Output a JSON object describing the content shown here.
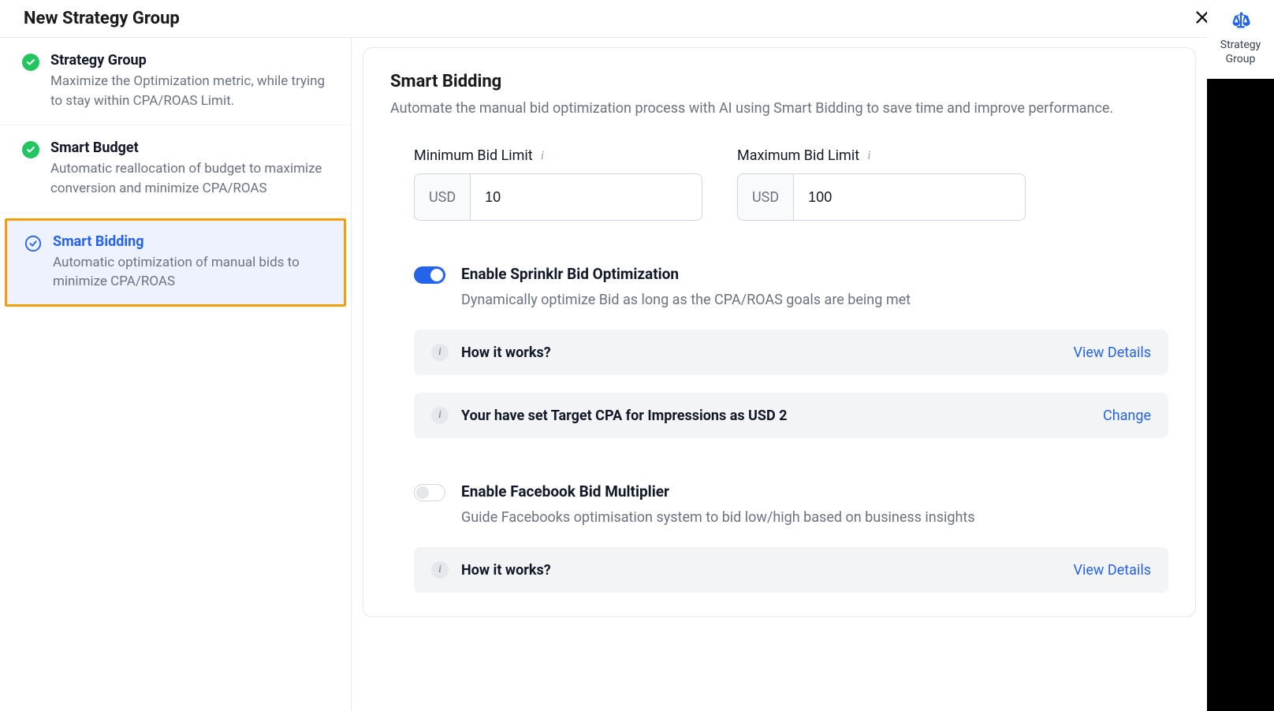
{
  "header": {
    "title": "New Strategy Group"
  },
  "rightRail": {
    "label": "Strategy Group"
  },
  "sidebar": {
    "items": [
      {
        "title": "Strategy Group",
        "desc": "Maximize the Optimization metric, while trying to stay within CPA/ROAS Limit."
      },
      {
        "title": "Smart Budget",
        "desc": "Automatic reallocation of budget to maximize conversion and minimize CPA/ROAS"
      },
      {
        "title": "Smart Bidding",
        "desc": "Automatic optimization of manual bids to minimize CPA/ROAS"
      }
    ]
  },
  "main": {
    "title": "Smart Bidding",
    "desc": "Automate the manual bid optimization process with AI using Smart Bidding to save time and improve performance.",
    "minBid": {
      "label": "Minimum Bid Limit",
      "currency": "USD",
      "value": "10"
    },
    "maxBid": {
      "label": "Maximum Bid Limit",
      "currency": "USD",
      "value": "100"
    },
    "sprinklr": {
      "title": "Enable Sprinklr Bid Optimization",
      "desc": "Dynamically optimize Bid as long as the CPA/ROAS goals are being met",
      "howItWorks": "How it works?",
      "viewDetails": "View Details",
      "targetText": "Your have set Target CPA for Impressions as USD 2",
      "changeLabel": "Change"
    },
    "facebook": {
      "title": "Enable Facebook Bid Multiplier",
      "desc": "Guide Facebooks optimisation system to bid low/high based on business insights",
      "howItWorks": "How it works?",
      "viewDetails": "View Details"
    }
  }
}
